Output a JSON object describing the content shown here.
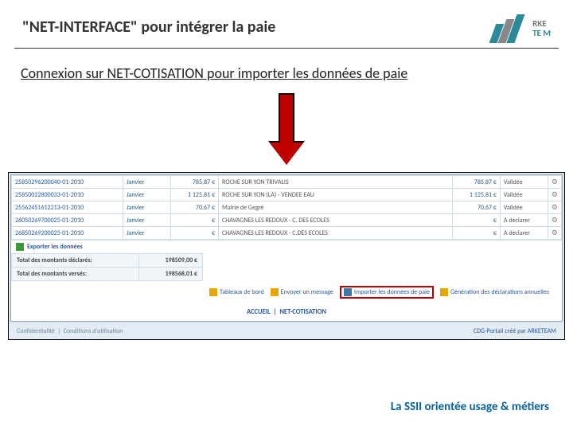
{
  "header": {
    "title": "\"NET-INTERFACE\" pour intégrer la paie",
    "logo": {
      "line1": "RKE",
      "line2": "TE  M"
    }
  },
  "subtitle": "Connexion sur NET-COTISATION pour importer les données de paie",
  "table": {
    "rows": [
      {
        "ref": "25850296200040-01-2010",
        "month": "Janvier",
        "amount": "785,87 €",
        "municipality": "ROCHE SUR YON   TRIVALIS",
        "amount2": "785,87 €",
        "status": "Validée"
      },
      {
        "ref": "25850022800033-01-2010",
        "month": "Janvier",
        "amount": "1 125,81 €",
        "municipality": "ROCHE SUR YON (LA) - VENDEE EAU",
        "amount2": "1 125,81 €",
        "status": "Validée"
      },
      {
        "ref": "25562451612213-01-2010",
        "month": "Janvier",
        "amount": "70,67 €",
        "municipality": "Mairie de Gegré",
        "amount2": "70,67 €",
        "status": "Validée"
      },
      {
        "ref": "26050269700025-01-2010",
        "month": "Janvier",
        "amount": "€",
        "municipality": "CHAVAGNES LES REDOUX - C. DES ECOLES",
        "amount2": "€",
        "status": "A déclarer"
      },
      {
        "ref": "26850269200025-01-2010",
        "month": "Janvier",
        "amount": "€",
        "municipality": "CHAVAGNES LES REDOUX - C.DES ECOLES",
        "amount2": "€",
        "status": "A déclarer"
      }
    ]
  },
  "export_link": "Exporter les données",
  "totals": {
    "declared_label": "Total des montants déclarés:",
    "declared_value": "198509,00 €",
    "paid_label": "Total des montants versés:",
    "paid_value": "198568,01 €"
  },
  "actions": {
    "dashboard": "Tableaux de bord",
    "message": "Envoyer un message",
    "import": "Importer les données de paie",
    "generate": "Génération des déclarations annuelles"
  },
  "breadcrumb": {
    "home": "ACCUEIL",
    "sep": "|",
    "section": "NET-COTISATION"
  },
  "footer": {
    "privacy": "Confidentialité",
    "sep": "|",
    "terms": "Conditions d'utilisation",
    "credit_prefix": "CDG-Portail créé par ",
    "credit_brand": "ARKETEAM"
  },
  "slide_footer": "La SSII orientée usage & métiers"
}
